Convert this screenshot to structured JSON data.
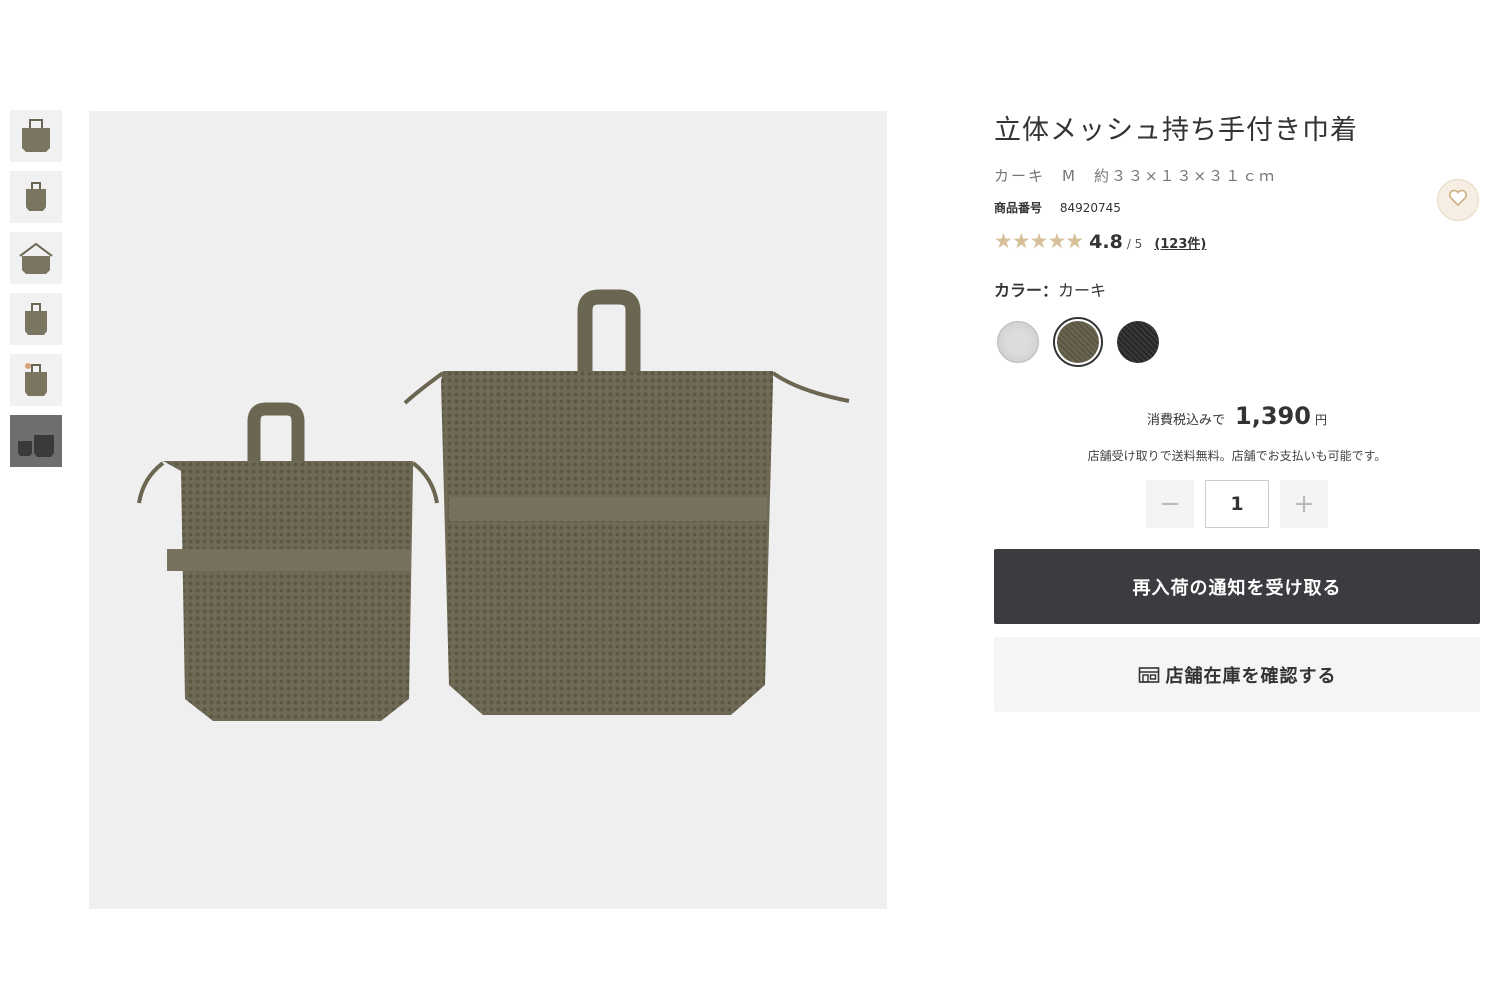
{
  "product": {
    "title": "立体メッシュ持ち手付き巾着",
    "variant": "カーキ　M　約３３×１３×３１ｃｍ",
    "sku_label": "商品番号",
    "sku": "84920745",
    "rating": {
      "stars": "★★★★★",
      "score": "4.8",
      "out_of": "/ 5",
      "count": "(123件)",
      "value": 4.8
    }
  },
  "color": {
    "label": "カラー：",
    "selected": "カーキ",
    "swatches": [
      {
        "name": "light-gray",
        "hex": "#d0d0d0"
      },
      {
        "name": "khaki",
        "hex": "#6b6651"
      },
      {
        "name": "black",
        "hex": "#343434"
      }
    ]
  },
  "price": {
    "tax_label": "消費税込みで",
    "amount": "1,390",
    "currency": "円"
  },
  "shipping_note": "店舗受け取りで送料無料。店舗でお支払いも可能です。",
  "quantity": {
    "value": "1",
    "minus": "−",
    "plus": "+"
  },
  "buttons": {
    "notify": "再入荷の通知を受け取る",
    "stock": "店舗在庫を確認する"
  },
  "colors": {
    "primary_button": "#3c3b3f",
    "star": "#d6bf99",
    "favorite_bg": "#f6eee2"
  },
  "icons": {
    "favorite": "heart-icon",
    "store": "store-icon"
  }
}
